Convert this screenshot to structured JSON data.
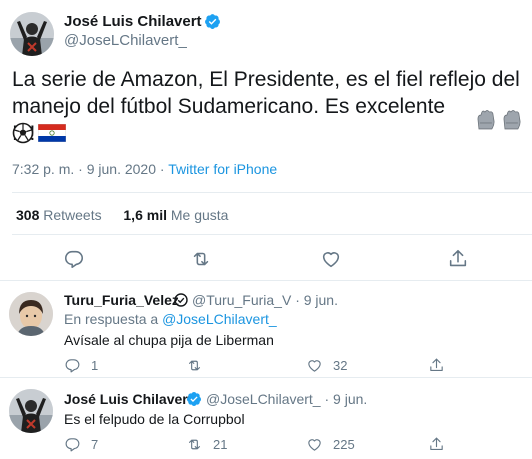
{
  "colors": {
    "link": "#1b95e0",
    "muted": "#657786",
    "text": "#14171a",
    "verified": "#1da1f2",
    "divider": "#e6ecf0"
  },
  "main_tweet": {
    "author_name": "José Luis Chilavert",
    "author_handle": "@JoseLChilavert_",
    "verified": true,
    "text_line1": "La serie de Amazon, El Presidente, es el fiel reflejo del",
    "text_line2": "manejo del fútbol Sudamericano. Es excelente !!!!",
    "emojis": [
      "goalkeeper-glove",
      "goalkeeper-glove",
      "soccer-ball",
      "paraguay-flag"
    ],
    "time": "7:32 p. m.",
    "separator": "·",
    "date": "9 jun. 2020",
    "source": "Twitter for iPhone",
    "retweets_count": "308",
    "retweets_label": "Retweets",
    "likes_count": "1,6 mil",
    "likes_label": "Me gusta",
    "actions": [
      "reply-icon",
      "retweet-icon",
      "like-icon",
      "share-icon"
    ]
  },
  "replies": [
    {
      "author_name": "Turu_Furia_Velez",
      "author_handle": "@Turu_Furia_V",
      "time": "· 9 jun.",
      "reply_prefix": "En respuesta a",
      "reply_mention": "@JoseLChilavert_",
      "text": "Avísale al chupa pija de Liberman",
      "reply_count": "1",
      "retweet_count": "",
      "like_count": "32"
    },
    {
      "author_name": "José Luis Chilavert",
      "author_handle": "@JoseLChilavert_",
      "verified": true,
      "time": "· 9 jun.",
      "text": "Es el felpudo de la Corrupbol",
      "reply_count": "7",
      "retweet_count": "21",
      "like_count": "225"
    }
  ]
}
